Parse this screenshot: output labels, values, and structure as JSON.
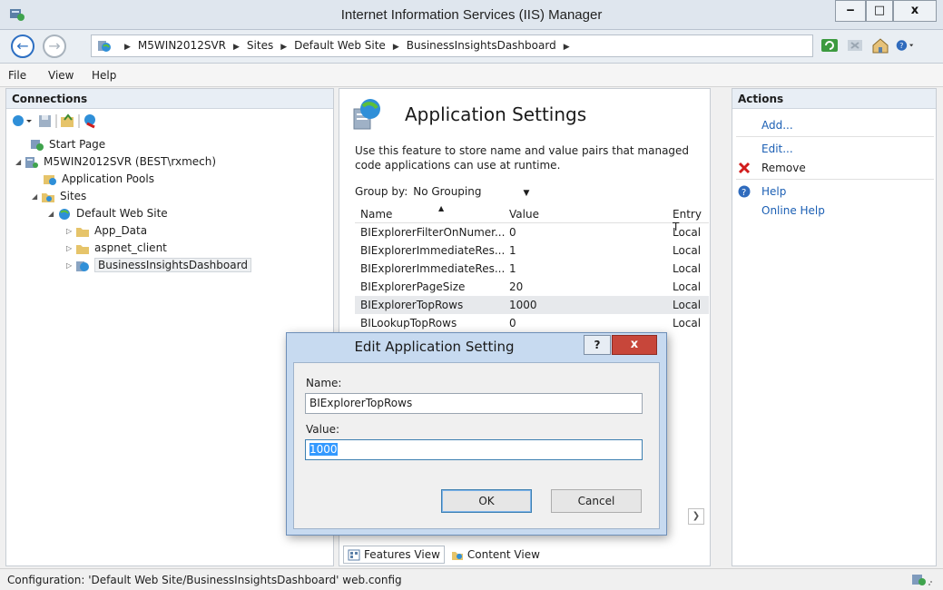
{
  "window": {
    "title": "Internet Information Services (IIS) Manager",
    "min_glyph": "‒",
    "max_glyph": "□",
    "close_glyph": "x"
  },
  "address": {
    "back_glyph": "←",
    "forward_glyph": "→",
    "crumbs": [
      "M5WIN2012SVR",
      "Sites",
      "Default Web Site",
      "BusinessInsightsDashboard"
    ]
  },
  "menu": {
    "file": "File",
    "view": "View",
    "help": "Help"
  },
  "connections": {
    "header": "Connections",
    "tree": {
      "start_page": "Start Page",
      "server": "M5WIN2012SVR (BEST\\rxmech)",
      "app_pools": "Application Pools",
      "sites": "Sites",
      "default_site": "Default Web Site",
      "app_data": "App_Data",
      "aspnet_client": "aspnet_client",
      "bid": "BusinessInsightsDashboard"
    }
  },
  "feature": {
    "title": "Application Settings",
    "description": "Use this feature to store name and value pairs that managed code applications can use at runtime.",
    "group_by_label": "Group by:",
    "group_by_value": "No Grouping",
    "columns": {
      "name": "Name",
      "value": "Value",
      "entry": "Entry T"
    },
    "rows": [
      {
        "name": "BIExplorerFilterOnNumer...",
        "value": "0",
        "entry": "Local"
      },
      {
        "name": "BIExplorerImmediateRes...",
        "value": "1",
        "entry": "Local"
      },
      {
        "name": "BIExplorerImmediateRes...",
        "value": "1",
        "entry": "Local"
      },
      {
        "name": "BIExplorerPageSize",
        "value": "20",
        "entry": "Local"
      },
      {
        "name": "BIExplorerTopRows",
        "value": "1000",
        "entry": "Local"
      },
      {
        "name": "BILookupTopRows",
        "value": "0",
        "entry": "Local"
      }
    ],
    "features_view": "Features View",
    "content_view": "Content View"
  },
  "actions": {
    "header": "Actions",
    "add": "Add...",
    "edit": "Edit...",
    "remove": "Remove",
    "help": "Help",
    "online_help": "Online Help"
  },
  "status": {
    "text": "Configuration: 'Default Web Site/BusinessInsightsDashboard' web.config"
  },
  "dialog": {
    "title": "Edit Application Setting",
    "help_glyph": "?",
    "close_glyph": "x",
    "name_label": "Name:",
    "name_value": "BIExplorerTopRows",
    "value_label": "Value:",
    "value_value": "1000",
    "ok": "OK",
    "cancel": "Cancel"
  },
  "colors": {
    "link": "#1b5fb4",
    "remove": "#d11c1c",
    "close_button": "#c7463a",
    "selection": "#3399ff"
  }
}
